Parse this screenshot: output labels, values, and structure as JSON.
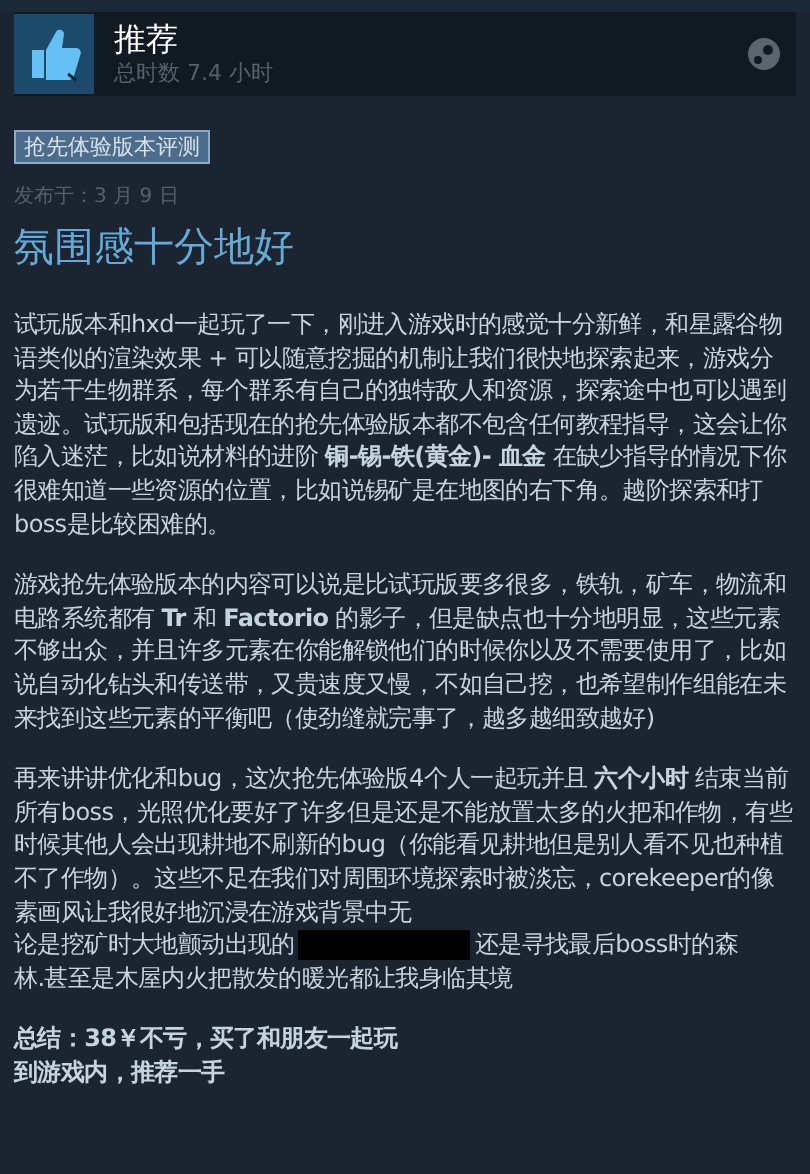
{
  "header": {
    "verdict": "推荐",
    "hours": "总时数 7.4 小时"
  },
  "tag": "抢先体验版本评测",
  "posted": "发布于：3 月 9 日",
  "title": "氛围感十分地好",
  "paragraphs": [
    {
      "segments": [
        {
          "kind": "text",
          "text": "试玩版本和hxd一起玩了一下，刚进入游戏时的感觉十分新鲜，和星露谷物语类似的渲染效果 + 可以随意挖掘的机制让我们很快地探索起来，游戏分为若干生物群系，每个群系有自己的独特敌人和资源，探索途中也可以遇到遗迹。试玩版和包括现在的抢先体验版本都不包含任何教程指导，这会让你陷入迷茫，比如说材料的进阶 **铜-锡-铁(黄金)- 血金** 在缺少指导的情况下你很难知道一些资源的位置，比如说锡矿是在地图的右下角。越阶探索和打boss是比较困难的。"
        }
      ]
    },
    {
      "segments": [
        {
          "kind": "text",
          "text": "游戏抢先体验版本的内容可以说是比试玩版要多很多，铁轨，矿车，物流和电路系统都有 **Tr** 和 **Factorio** 的影子，但是缺点也十分地明显，这些元素不够出众，并且许多元素在你能解锁他们的时候你以及不需要使用了，比如说自动化钻头和传送带，又贵速度又慢，不如自己挖，也希望制作组能在未来找到这些元素的平衡吧（使劲缝就完事了，越多越细致越好)"
        }
      ]
    },
    {
      "segments": [
        {
          "kind": "text",
          "text": "再来讲讲优化和bug，这次抢先体验版4个人一起玩并且 **六个小时** 结束当前所有boss，光照优化要好了许多但是还是不能放置太多的火把和作物，有些时候其他人会出现耕地不刷新的bug（你能看见耕地但是别人看不见也种植不了作物）。这些不足在我们对周围环境探索时被淡忘，corekeeper的像素画风让我很好地沉浸在游戏背景中无"
        },
        {
          "kind": "row",
          "items": [
            {
              "kind": "text",
              "text": "论是挖矿时大地颤动出现的"
            },
            {
              "kind": "spoiler"
            },
            {
              "kind": "text",
              "text": "还是寻找最后boss时的森"
            }
          ]
        },
        {
          "kind": "text",
          "text": "林.甚至是木屋内火把散发的暖光都让我身临其境"
        }
      ]
    }
  ],
  "summary": [
    "总结：38￥不亏，买了和朋友一起玩",
    "到游戏内，推荐一手"
  ]
}
